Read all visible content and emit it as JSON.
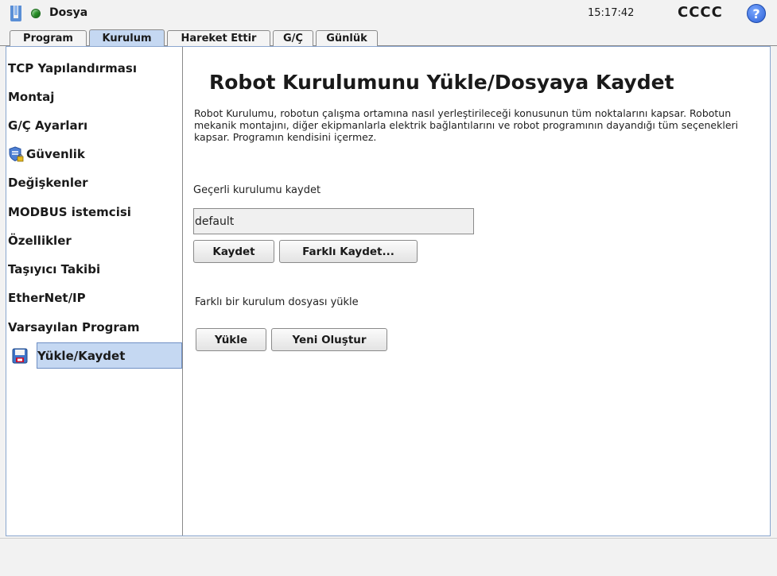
{
  "titlebar": {
    "file_menu": "Dosya",
    "clock": "15:17:42",
    "robot_name": "CCCC",
    "help_symbol": "?",
    "status_color": "#2a9a2a"
  },
  "tabs": [
    {
      "label": "Program",
      "active": false
    },
    {
      "label": "Kurulum",
      "active": true
    },
    {
      "label": "Hareket Ettir",
      "active": false
    },
    {
      "label": "G/Ç",
      "active": false
    },
    {
      "label": "Günlük",
      "active": false
    }
  ],
  "sidebar": {
    "items": [
      {
        "label": "TCP Yapılandırması"
      },
      {
        "label": "Montaj"
      },
      {
        "label": "G/Ç Ayarları"
      },
      {
        "label": "Güvenlik",
        "icon": "shield-lock-icon"
      },
      {
        "label": "Değişkenler"
      },
      {
        "label": "MODBUS istemcisi"
      },
      {
        "label": "Özellikler"
      },
      {
        "label": "Taşıyıcı Takibi"
      },
      {
        "label": "EtherNet/IP"
      },
      {
        "label": "Varsayılan Program"
      },
      {
        "label": "Yükle/Kaydet",
        "icon": "floppy-disk-icon",
        "selected": true
      }
    ]
  },
  "main": {
    "title": "Robot Kurulumunu Yükle/Dosyaya Kaydet",
    "description": "Robot Kurulumu, robotun çalışma ortamına nasıl yerleştirileceği konusunun tüm noktalarını kapsar. Robotun mekanik montajını, diğer ekipmanlarla elektrik bağlantılarını ve robot programının dayandığı tüm seçenekleri kapsar. Programın kendisini içermez.",
    "save_section_label": "Geçerli kurulumu kaydet",
    "current_installation": "default",
    "save_button": "Kaydet",
    "save_as_button": "Farklı Kaydet...",
    "load_section_label": "Farklı bir kurulum dosyası yükle",
    "load_button": "Yükle",
    "new_button": "Yeni Oluştur"
  },
  "colors": {
    "accent": "#c5d8f2",
    "panel_border": "#8aa6cf"
  }
}
